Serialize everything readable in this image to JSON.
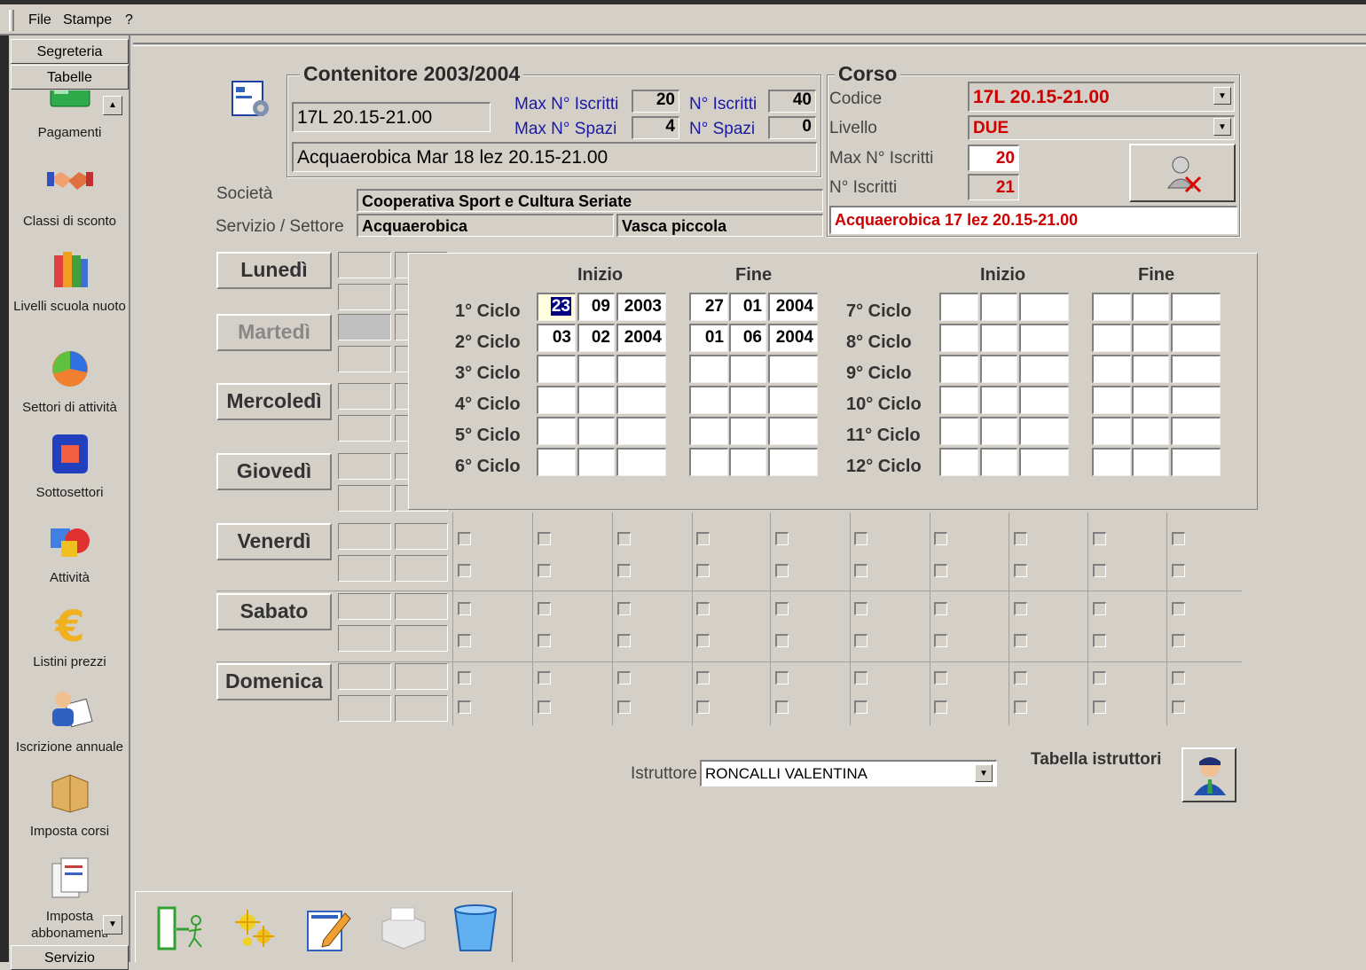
{
  "menu": {
    "items": [
      "File",
      "Stampe",
      "?"
    ]
  },
  "sidebar": {
    "tab_top1": "Segreteria",
    "tab_top2": "Tabelle",
    "tab_bottom": "Servizio",
    "items": [
      {
        "label": "Pagamenti",
        "icon": "payments-icon"
      },
      {
        "label": "Classi di sconto",
        "icon": "handshake-icon"
      },
      {
        "label": "Livelli scuola nuoto",
        "icon": "books-icon"
      },
      {
        "label": "Settori di attività",
        "icon": "pie-chart-icon"
      },
      {
        "label": "Sottosettori",
        "icon": "square-icon"
      },
      {
        "label": "Attività",
        "icon": "shapes-icon"
      },
      {
        "label": "Listini prezzi",
        "icon": "euro-icon"
      },
      {
        "label": "Iscrizione annuale",
        "icon": "person-document-icon"
      },
      {
        "label": "Imposta corsi",
        "icon": "box-icon"
      },
      {
        "label": "Imposta abbonamenti",
        "icon": "documents-icon"
      }
    ]
  },
  "contenitore": {
    "title": "Contenitore 2003/2004",
    "code": "17L 20.15-21.00",
    "description": "Acquaerobica Mar 18 lez 20.15-21.00",
    "max_iscritti_label": "Max N° Iscritti",
    "max_iscritti": "20",
    "n_iscritti_label": "N° Iscritti",
    "n_iscritti": "40",
    "max_spazi_label": "Max N° Spazi",
    "max_spazi": "4",
    "n_spazi_label": "N° Spazi",
    "n_spazi": "0"
  },
  "societa": {
    "label": "Società",
    "value": "Cooperativa Sport e Cultura Seriate",
    "servizio_label": "Servizio / Settore",
    "servizio": "Acquaerobica",
    "settore": "Vasca piccola"
  },
  "corso": {
    "title": "Corso",
    "codice_label": "Codice",
    "codice": "17L 20.15-21.00",
    "livello_label": "Livello",
    "livello": "DUE",
    "max_iscritti_label": "Max N° Iscritti",
    "max_iscritti": "20",
    "n_iscritti_label": "N° Iscritti",
    "n_iscritti": "21",
    "description": "Acquaerobica 17 lez 20.15-21.00",
    "accent": "#cc0000"
  },
  "days": [
    "Lunedì",
    "Martedì",
    "Mercoledì",
    "Giovedì",
    "Venerdì",
    "Sabato",
    "Domenica"
  ],
  "cycles": {
    "head_inizio": "Inizio",
    "head_fine": "Fine",
    "left": [
      {
        "label": "1° Ciclo",
        "start": [
          "23",
          "09",
          "2003"
        ],
        "end": [
          "27",
          "01",
          "2004"
        ]
      },
      {
        "label": "2° Ciclo",
        "start": [
          "03",
          "02",
          "2004"
        ],
        "end": [
          "01",
          "06",
          "2004"
        ]
      },
      {
        "label": "3° Ciclo",
        "start": [
          "",
          "",
          ""
        ],
        "end": [
          "",
          "",
          ""
        ]
      },
      {
        "label": "4° Ciclo",
        "start": [
          "",
          "",
          ""
        ],
        "end": [
          "",
          "",
          ""
        ]
      },
      {
        "label": "5° Ciclo",
        "start": [
          "",
          "",
          ""
        ],
        "end": [
          "",
          "",
          ""
        ]
      },
      {
        "label": "6° Ciclo",
        "start": [
          "",
          "",
          ""
        ],
        "end": [
          "",
          "",
          ""
        ]
      }
    ],
    "right": [
      {
        "label": "7° Ciclo"
      },
      {
        "label": "8° Ciclo"
      },
      {
        "label": "9° Ciclo"
      },
      {
        "label": "10° Ciclo"
      },
      {
        "label": "11° Ciclo"
      },
      {
        "label": "12° Ciclo"
      }
    ]
  },
  "istruttore": {
    "label": "Istruttore",
    "value": "RONCALLI VALENTINA",
    "tabella_label": "Tabella istruttori"
  },
  "toolbar": {
    "buttons": [
      "exit-icon",
      "sparkle-icon",
      "edit-icon",
      "print-icon",
      "delete-icon"
    ]
  }
}
